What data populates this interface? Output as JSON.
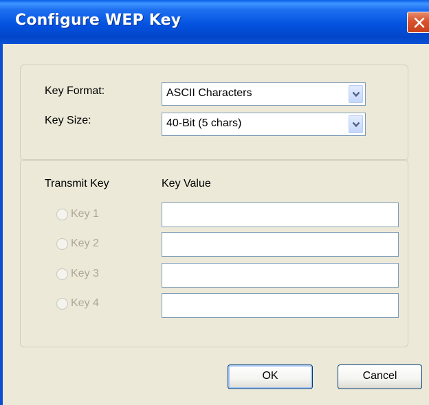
{
  "window": {
    "title": "Configure WEP Key"
  },
  "settings": {
    "key_format_label": "Key Format:",
    "key_format_value": "ASCII Characters",
    "key_size_label": "Key Size:",
    "key_size_value": "40-Bit (5 chars)"
  },
  "keys": {
    "transmit_header": "Transmit Key",
    "value_header": "Key Value",
    "items": [
      {
        "label": "Key 1",
        "value": ""
      },
      {
        "label": "Key 2",
        "value": ""
      },
      {
        "label": "Key 3",
        "value": ""
      },
      {
        "label": "Key 4",
        "value": ""
      }
    ]
  },
  "buttons": {
    "ok": "OK",
    "cancel": "Cancel"
  },
  "icons": {
    "close": "close-icon",
    "dropdown": "chevron-down-icon",
    "radio": "radio-button"
  },
  "colors": {
    "titlebar": "#0453e0",
    "close": "#d9532c",
    "dialog_bg": "#ece9d8",
    "disabled_text": "#aca899"
  }
}
